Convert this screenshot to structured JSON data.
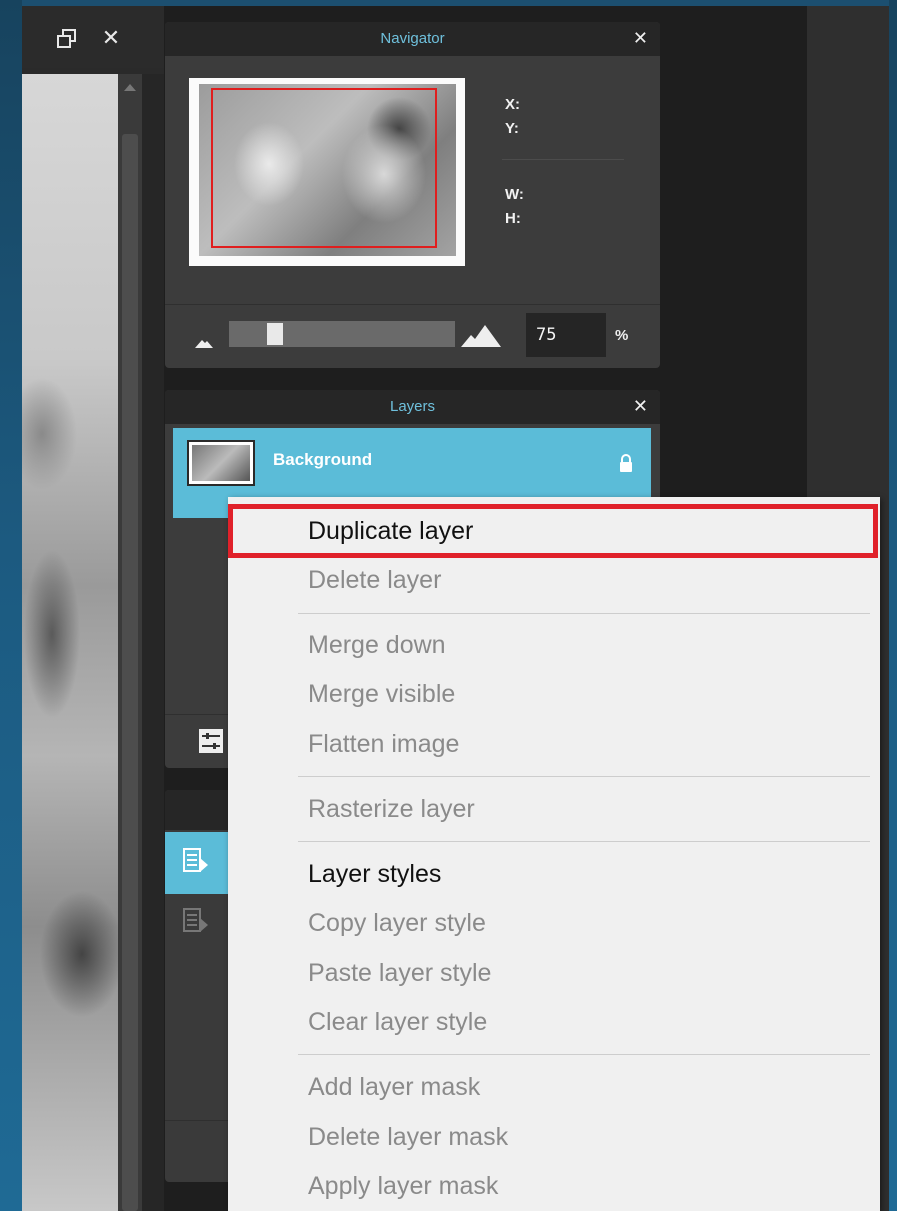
{
  "canvas_window": {
    "restore_icon": "restore-window-icon",
    "close_label": "✕"
  },
  "navigator": {
    "title": "Navigator",
    "close_label": "✕",
    "x_label": "X:",
    "y_label": "Y:",
    "w_label": "W:",
    "h_label": "H:",
    "zoom_value": "75",
    "zoom_unit": "%"
  },
  "layers": {
    "title": "Layers",
    "close_label": "✕",
    "items": [
      {
        "name": "Background",
        "locked": true
      }
    ]
  },
  "context_menu": {
    "highlight_color": "#e0212a",
    "items": [
      {
        "label": "Duplicate layer",
        "enabled": true,
        "highlighted": true
      },
      {
        "label": "Delete layer",
        "enabled": false
      },
      {
        "label": "Merge down",
        "enabled": false
      },
      {
        "label": "Merge visible",
        "enabled": false
      },
      {
        "label": "Flatten image",
        "enabled": false
      },
      {
        "label": "Rasterize layer",
        "enabled": false
      },
      {
        "label": "Layer styles",
        "enabled": true
      },
      {
        "label": "Copy layer style",
        "enabled": false
      },
      {
        "label": "Paste layer style",
        "enabled": false
      },
      {
        "label": "Clear layer style",
        "enabled": false
      },
      {
        "label": "Add layer mask",
        "enabled": false
      },
      {
        "label": "Delete layer mask",
        "enabled": false
      },
      {
        "label": "Apply layer mask",
        "enabled": false
      }
    ]
  },
  "colors": {
    "accent": "#5bbcd8",
    "panel_title": "#6fc0dc"
  }
}
